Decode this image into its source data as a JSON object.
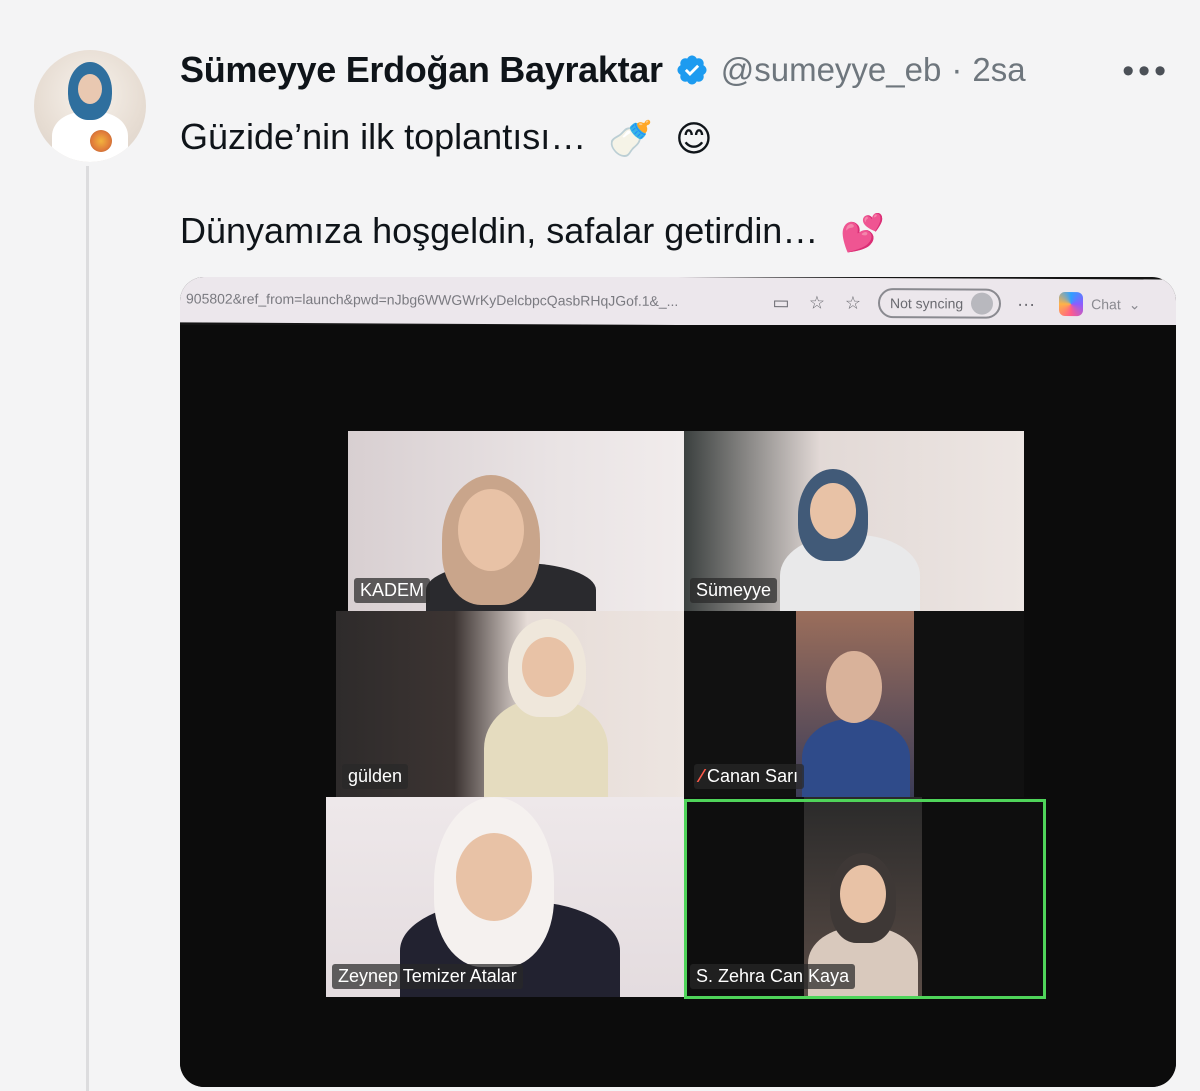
{
  "author": {
    "name": "Sümeyye Erdoğan Bayraktar",
    "handle": "@sumeyye_eb",
    "separator": "·",
    "time": "2sa",
    "more_icon": "more-horizontal-icon",
    "verified_color": "#1d9bf0"
  },
  "tweet": {
    "line1": "Güzide’nin ilk toplantısı…",
    "line2": "Dünyamıza hoşgeldin, safalar getirdin…",
    "emoji1": "🍼",
    "emoji2": "😊",
    "emoji3": "💕"
  },
  "photo": {
    "browser": {
      "url": "905802&ref_from=launch&pwd=nJbg6WWGWrKyDelcbpcQasbRHqJGof.1&_...",
      "sync_label": "Not syncing",
      "chat_label": "Chat",
      "more": "···"
    },
    "participants": [
      {
        "name": "KADEM",
        "muted": false
      },
      {
        "name": "Sümeyye",
        "muted": false
      },
      {
        "name": "gülden",
        "muted": false
      },
      {
        "name": "Canan Sarı",
        "muted": true
      },
      {
        "name": "Zeynep Temizer Atalar",
        "muted": false
      },
      {
        "name": "S. Zehra Can Kaya",
        "muted": false,
        "active_speaker": true
      }
    ],
    "mute_icon": "mic-off-icon",
    "speaker_color": "#4fd45a"
  }
}
